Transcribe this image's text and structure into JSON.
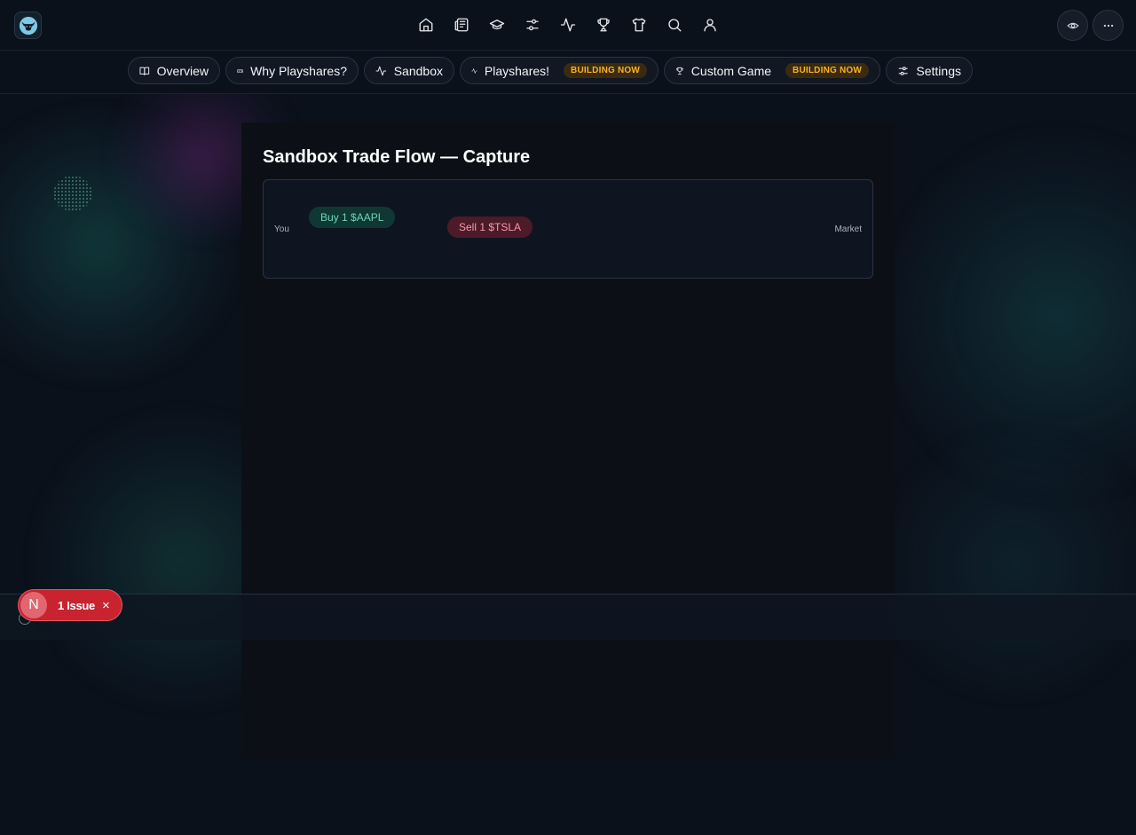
{
  "topbar": {
    "logo": "bull-logo-icon",
    "nav_icons": [
      "home-icon",
      "newspaper-icon",
      "graduation-cap-icon",
      "sliders-icon",
      "activity-icon",
      "trophy-icon",
      "shirt-icon",
      "search-icon",
      "user-icon"
    ],
    "right_icons": [
      "eye-icon",
      "more-horizontal-icon"
    ]
  },
  "tabs": [
    {
      "label": "Overview",
      "icon": "book-open-icon"
    },
    {
      "label": "Why Playshares?",
      "icon": "gamepad-icon"
    },
    {
      "label": "Sandbox",
      "icon": "activity-icon"
    },
    {
      "label": "Playshares!",
      "icon": "activity-icon",
      "badge": "BUILDING NOW"
    },
    {
      "label": "Custom Game",
      "icon": "trophy-icon",
      "badge": "BUILDING NOW"
    },
    {
      "label": "Settings",
      "icon": "sliders-icon"
    }
  ],
  "main": {
    "title": "Sandbox Trade Flow — Capture",
    "flow": {
      "left_label": "You",
      "right_label": "Market",
      "buy_label": "Buy 1 $AAPL",
      "sell_label": "Sell 1 $TSLA"
    }
  },
  "issue_badge": {
    "avatar_letter": "N",
    "label": "1 Issue",
    "close": "×"
  },
  "colors": {
    "background": "#0b111b",
    "badge_text": "#f5b324",
    "buy": "#6fd4b4",
    "sell": "#f69aa8",
    "issue": "#c8232f"
  }
}
